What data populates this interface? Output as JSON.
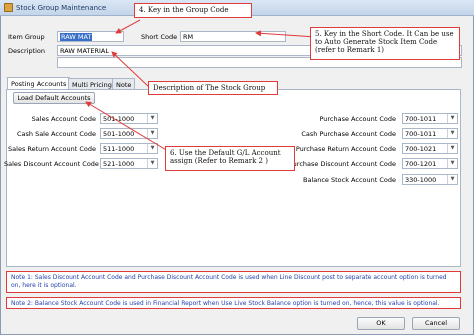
{
  "window": {
    "title": "Stock Group Maintenance"
  },
  "form": {
    "item_group_label": "Item Group",
    "item_group_value": "RAW MAT",
    "short_code_label": "Short Code",
    "short_code_value": "RM",
    "description_label": "Description",
    "description_value": "RAW MATERIAL"
  },
  "tabs": [
    {
      "label": "Posting Accounts"
    },
    {
      "label": "Multi Pricing"
    },
    {
      "label": "Note"
    }
  ],
  "load_default_label": "Load Default Accounts",
  "left_accounts": [
    {
      "label": "Sales Account Code",
      "value": "501-1000"
    },
    {
      "label": "Cash Sale Account Code",
      "value": "501-1000"
    },
    {
      "label": "Sales Return Account Code",
      "value": "511-1000"
    },
    {
      "label": "Sales Discount Account Code",
      "value": "521-1000"
    }
  ],
  "right_accounts": [
    {
      "label": "Purchase Account Code",
      "value": "700-1011"
    },
    {
      "label": "Cash Purchase Account Code",
      "value": "700-1011"
    },
    {
      "label": "Purchase Return Account Code",
      "value": "700-1021"
    },
    {
      "label": "Purchase Discount Account Code",
      "value": "700-1201"
    },
    {
      "label": "Balance Stock Account Code",
      "value": "330-1000"
    }
  ],
  "callouts": {
    "c4": "4. Key in the Group Code",
    "c5": "5. Key in the Short Code. It Can be use to Auto Generate Stock Item Code (refer to Remark 1)",
    "desc": "Description of The Stock Group",
    "c6": "6. Use the Default G/L Account assign (Refer to Remark 2 )"
  },
  "notes": {
    "note1": "Note 1: Sales Discount Account Code and Purchase Discount Account Code is used when Line Discount post to separate account option is turned on, here it is optional.",
    "note2": "Note 2: Balance Stock Account Code is used in Financial Report when Use Live Stock Balance option is turned on, hence, this value is optional."
  },
  "buttons": {
    "ok": "OK",
    "cancel": "Cancel"
  },
  "colors": {
    "annotation": "#e03a3a",
    "note_text": "#1f3fae",
    "selection": "#3a6fc8"
  }
}
